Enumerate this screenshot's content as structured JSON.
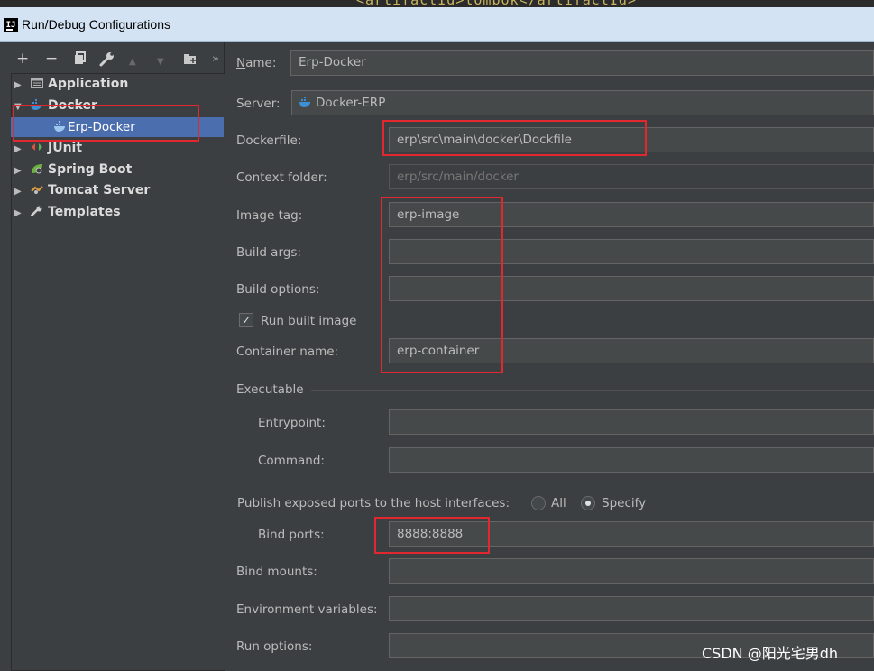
{
  "editor_snippet": "<artifactId>lombok</artifactId>",
  "window": {
    "title": "Run/Debug Configurations",
    "app_icon": "IJ"
  },
  "toolbar": {
    "add": "+",
    "remove": "−",
    "copy": "⧉",
    "edit_defaults": "wrench",
    "move_up": "▲",
    "move_down": "▼",
    "folder": "folder-plus",
    "more": "»"
  },
  "tree": {
    "application": "Application",
    "docker": "Docker",
    "erp_docker": "Erp-Docker",
    "junit": "JUnit",
    "spring_boot": "Spring Boot",
    "tomcat": "Tomcat Server",
    "templates": "Templates"
  },
  "form": {
    "name_label_prefix": "N",
    "name_label_rest": "ame:",
    "name_value": "Erp-Docker",
    "server_label": "Server:",
    "server_value": "Docker-ERP",
    "dockerfile_label": "Dockerfile:",
    "dockerfile_value": "erp\\src\\main\\docker\\Dockfile",
    "context_label": "Context folder:",
    "context_value": "erp/src/main/docker",
    "image_tag_label": "Image tag:",
    "image_tag_value": "erp-image",
    "build_args_label": "Build args:",
    "build_args_value": "",
    "build_options_label": "Build options:",
    "build_options_value": "",
    "run_built_label": "Run built image",
    "run_built_checked": true,
    "container_label": "Container name:",
    "container_value": "erp-container",
    "executable_section": "Executable",
    "entrypoint_label": "Entrypoint:",
    "entrypoint_value": "",
    "command_label": "Command:",
    "command_value": "",
    "publish_label": "Publish exposed ports to the host interfaces:",
    "radio_all": "All",
    "radio_specify": "Specify",
    "selected_radio": "Specify",
    "bind_ports_label": "Bind ports:",
    "bind_ports_value": "8888:8888",
    "bind_mounts_label": "Bind mounts:",
    "bind_mounts_value": "",
    "env_label": "Environment variables:",
    "env_value": "",
    "run_options_label": "Run options:",
    "run_options_value": ""
  },
  "watermark": "CSDN @阳光宅男dh",
  "colors": {
    "highlight_box": "#e0282e",
    "selection": "#4b6eaf",
    "background": "#3c3f41"
  }
}
